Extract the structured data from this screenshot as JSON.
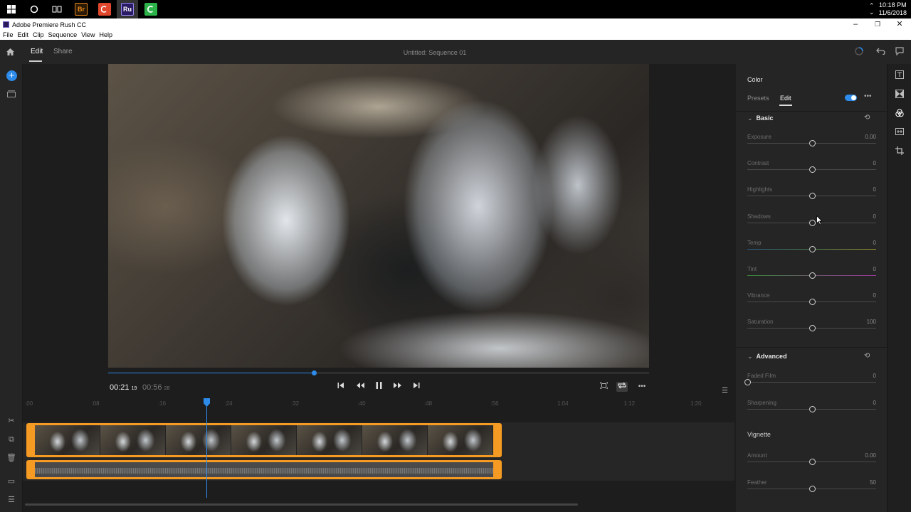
{
  "taskbar": {
    "apps": [
      {
        "icon": "windows-start-icon"
      },
      {
        "icon": "cortana-search-icon"
      },
      {
        "icon": "task-view-icon"
      },
      {
        "label": "Br",
        "color": "#e68619",
        "bg": "#2b1a05"
      },
      {
        "label": "",
        "color": "#fff",
        "bg": "#e0472c"
      },
      {
        "label": "Ru",
        "color": "#ffffff",
        "bg": "#2a1a63"
      },
      {
        "label": "",
        "color": "#fff",
        "bg": "#2db34a"
      }
    ],
    "time": "10:18 PM",
    "date": "11/6/2018"
  },
  "window": {
    "title": "Adobe Premiere Rush CC",
    "menu": [
      "File",
      "Edit",
      "Clip",
      "Sequence",
      "View",
      "Help"
    ]
  },
  "header": {
    "tabs": {
      "edit": "Edit",
      "share": "Share"
    },
    "sequence_title": "Untitled: Sequence 01"
  },
  "viewer": {
    "current_time": "00:21",
    "current_frames": "19",
    "total_time": "00:56",
    "total_frames": "28",
    "progress": 0.38
  },
  "timeline": {
    "ruler": [
      ":00",
      ":08",
      ":16",
      ":24",
      ":32",
      ":40",
      ":48",
      ":56",
      "1:04",
      "1:12",
      "1:20"
    ],
    "playhead_time_fraction": 0.38,
    "thumbnail_count": 7
  },
  "color_panel": {
    "title": "Color",
    "tabs": {
      "presets": "Presets",
      "edit": "Edit"
    },
    "basic": {
      "label": "Basic",
      "sliders": [
        {
          "label": "Exposure",
          "value": "0.00",
          "position": 0.5
        },
        {
          "label": "Contrast",
          "value": "0",
          "position": 0.5
        },
        {
          "label": "Highlights",
          "value": "0",
          "position": 0.5
        },
        {
          "label": "Shadows",
          "value": "0",
          "position": 0.5
        },
        {
          "label": "Temp",
          "value": "0",
          "position": 0.5
        },
        {
          "label": "Tint",
          "value": "0",
          "position": 0.5
        },
        {
          "label": "Vibrance",
          "value": "0",
          "position": 0.5
        },
        {
          "label": "Saturation",
          "value": "100",
          "position": 0.5
        }
      ]
    },
    "advanced": {
      "label": "Advanced",
      "sliders": [
        {
          "label": "Faded Film",
          "value": "0",
          "position": 0.0
        },
        {
          "label": "Sharpening",
          "value": "0",
          "position": 0.5
        }
      ],
      "vignette_label": "Vignette",
      "vignette_sliders": [
        {
          "label": "Amount",
          "value": "0.00",
          "position": 0.5
        },
        {
          "label": "Feather",
          "value": "50",
          "position": 0.5
        }
      ]
    }
  },
  "colors": {
    "accent": "#2d8ceb",
    "clip_border": "#f59a23"
  }
}
